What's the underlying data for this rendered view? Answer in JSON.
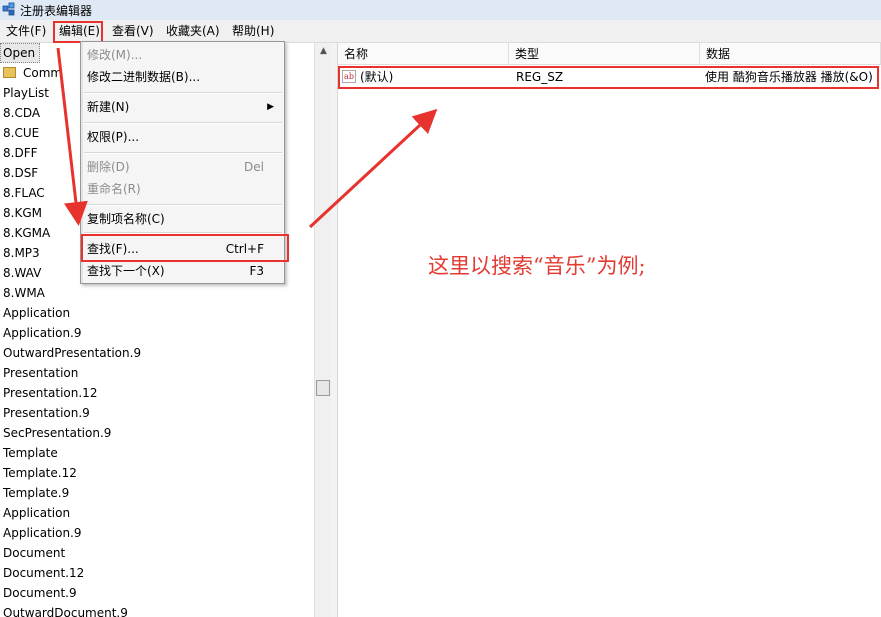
{
  "window": {
    "title": "注册表编辑器"
  },
  "menubar": {
    "items": [
      {
        "label": "文件(F)"
      },
      {
        "label": "编辑(E)"
      },
      {
        "label": "查看(V)"
      },
      {
        "label": "收藏夹(A)"
      },
      {
        "label": "帮助(H)"
      }
    ]
  },
  "tree": {
    "items": [
      "Open",
      "Comm",
      "PlayList",
      "8.CDA",
      "8.CUE",
      "8.DFF",
      "8.DSF",
      "8.FLAC",
      "8.KGM",
      "8.KGMA",
      "8.MP3",
      "8.WAV",
      "8.WMA",
      "Application",
      "Application.9",
      "OutwardPresentation.9",
      "Presentation",
      "Presentation.12",
      "Presentation.9",
      "SecPresentation.9",
      "Template",
      "Template.12",
      "Template.9",
      "Application",
      "Application.9",
      "Document",
      "Document.12",
      "Document.9",
      "OutwardDocument.9"
    ]
  },
  "list": {
    "columns": [
      "名称",
      "类型",
      "数据"
    ],
    "rows": [
      {
        "name": "(默认)",
        "type": "REG_SZ",
        "data": "使用 酷狗音乐播放器 播放(&O)",
        "icon": "string-value-icon"
      }
    ]
  },
  "edit_menu": {
    "modify": "修改(M)...",
    "modify_binary": "修改二进制数据(B)...",
    "new": "新建(N)",
    "permissions": "权限(P)...",
    "delete": "删除(D)",
    "delete_key": "Del",
    "rename": "重命名(R)",
    "copy_key_name": "复制项名称(C)",
    "find": "查找(F)...",
    "find_key": "Ctrl+F",
    "find_next": "查找下一个(X)",
    "find_next_key": "F3"
  },
  "annotation": {
    "text": "这里以搜索“音乐”为例;"
  },
  "colors": {
    "highlight_red": "#e8322e",
    "annotation_red": "#e23b32"
  }
}
